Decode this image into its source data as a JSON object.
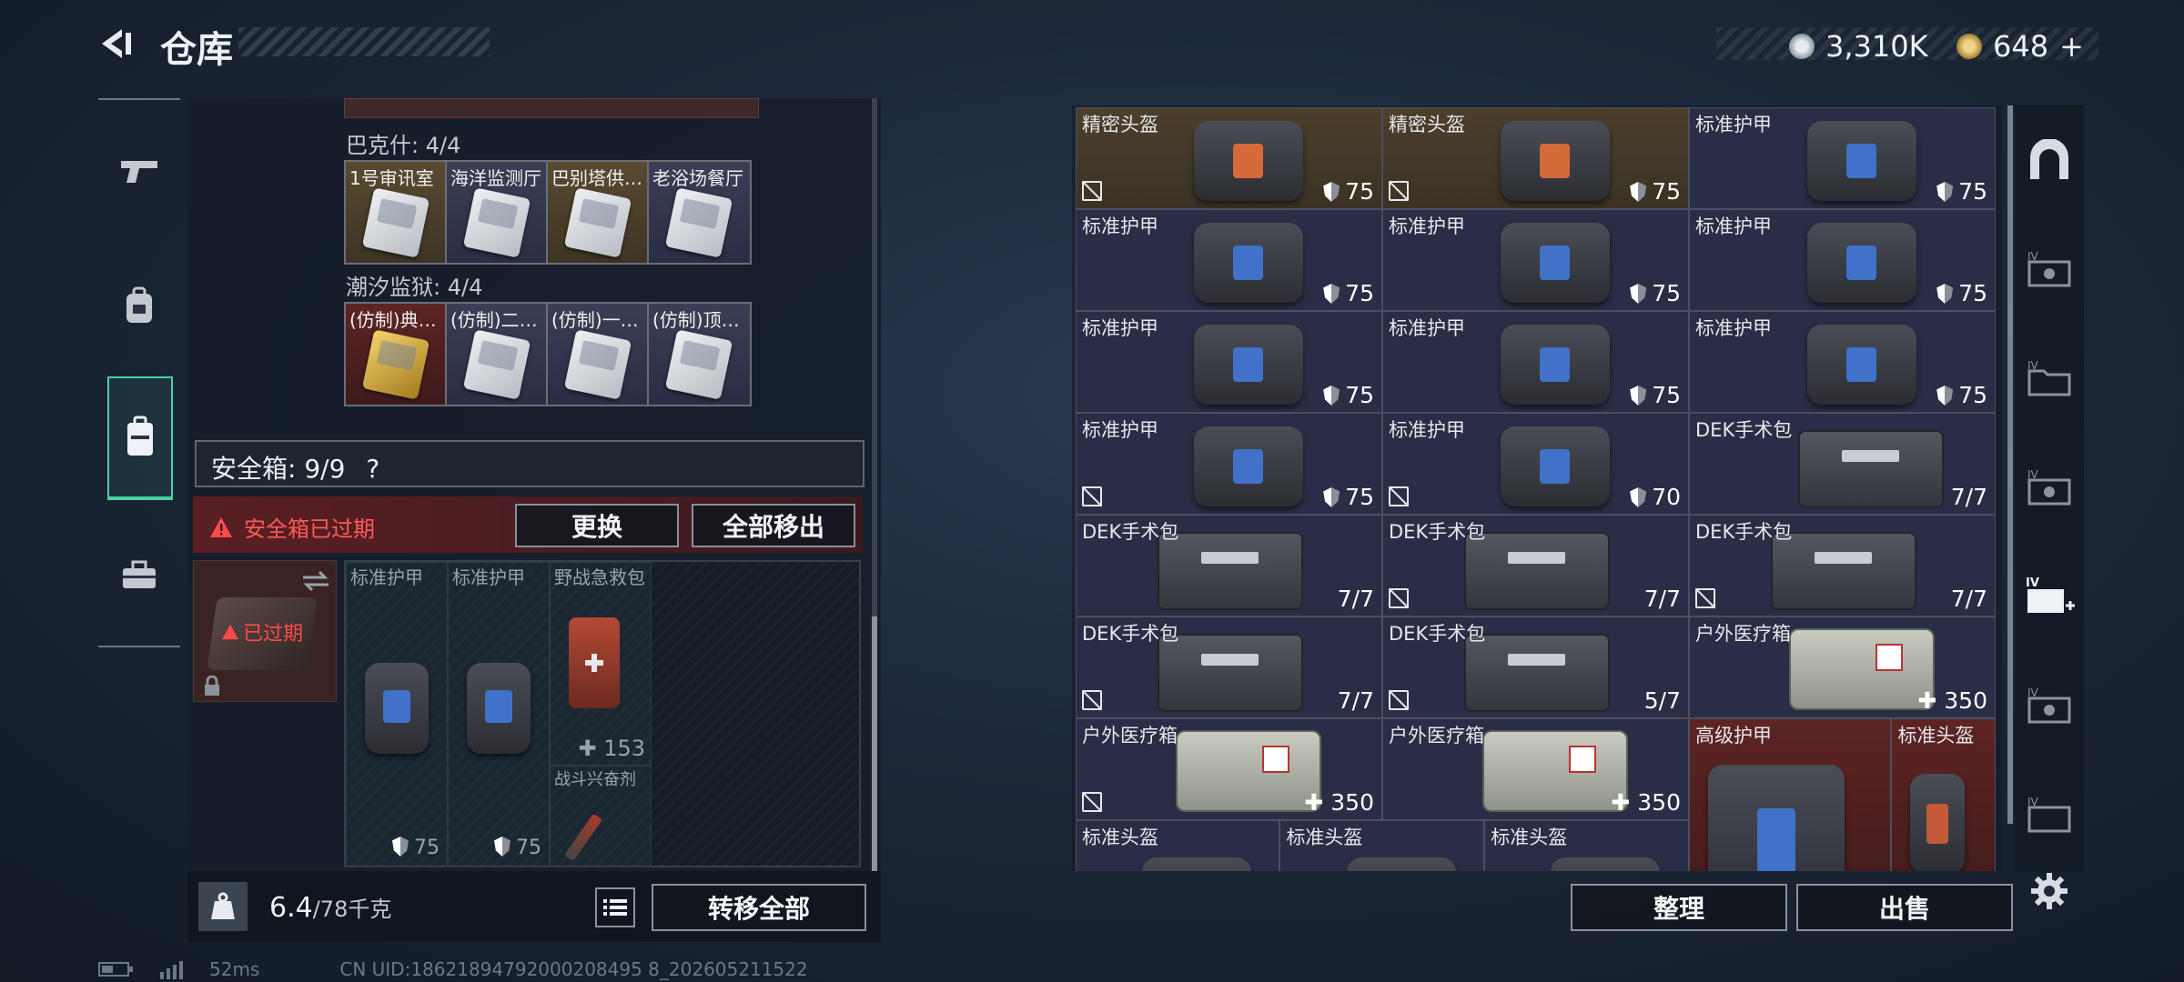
{
  "header": {
    "title": "仓库"
  },
  "currency": {
    "silver": "3,310K",
    "gold": "648",
    "gold_plus": "+"
  },
  "left": {
    "section_a": "巴克什: 4/4",
    "cards_a": [
      "1号审讯室",
      "海洋监测厅",
      "巴别塔供…",
      "老浴场餐厅"
    ],
    "section_b": "潮汐监狱: 4/4",
    "cards_b": [
      "(仿制)典…",
      "(仿制)二…",
      "(仿制)一…",
      "(仿制)顶…"
    ],
    "safe_label": "安全箱: 9/9",
    "safe_help": "?",
    "expired_warning": "安全箱已过期",
    "replace_button": "更换",
    "move_all_out_button": "全部移出",
    "expired_badge": "已过期",
    "safe_items": [
      {
        "name": "标准护甲",
        "value": "75"
      },
      {
        "name": "标准护甲",
        "value": "75"
      },
      {
        "name": "野战急救包",
        "value": "153"
      },
      {
        "name": "战斗兴奋剂",
        "value": ""
      }
    ],
    "weight_value": "6.4",
    "weight_max": "/78千克",
    "transfer_all_button": "转移全部"
  },
  "inventory": [
    {
      "name": "精密头盔",
      "value": "75",
      "type": "armor",
      "nosell": true,
      "bg": "gold"
    },
    {
      "name": "精密头盔",
      "value": "75",
      "type": "armor",
      "nosell": true,
      "bg": "gold"
    },
    {
      "name": "标准护甲",
      "value": "75",
      "type": "armor",
      "nosell": false,
      "bg": "blue"
    },
    {
      "name": "标准护甲",
      "value": "75",
      "type": "armor",
      "nosell": false,
      "bg": "blue"
    },
    {
      "name": "标准护甲",
      "value": "75",
      "type": "armor",
      "nosell": false,
      "bg": "blue"
    },
    {
      "name": "标准护甲",
      "value": "75",
      "type": "armor",
      "nosell": false,
      "bg": "blue"
    },
    {
      "name": "标准护甲",
      "value": "75",
      "type": "armor",
      "nosell": false,
      "bg": "blue"
    },
    {
      "name": "标准护甲",
      "value": "75",
      "type": "armor",
      "nosell": false,
      "bg": "blue"
    },
    {
      "name": "标准护甲",
      "value": "75",
      "type": "armor",
      "nosell": false,
      "bg": "blue"
    },
    {
      "name": "标准护甲",
      "value": "75",
      "type": "armor",
      "nosell": true,
      "bg": "blue"
    },
    {
      "name": "标准护甲",
      "value": "70",
      "type": "armor",
      "nosell": true,
      "bg": "blue"
    },
    {
      "name": "DEK手术包",
      "value": "7/7",
      "type": "kit",
      "nosell": false,
      "bg": "blue"
    },
    {
      "name": "DEK手术包",
      "value": "7/7",
      "type": "kit",
      "nosell": false,
      "bg": "blue"
    },
    {
      "name": "DEK手术包",
      "value": "7/7",
      "type": "kit",
      "nosell": true,
      "bg": "blue"
    },
    {
      "name": "DEK手术包",
      "value": "7/7",
      "type": "kit",
      "nosell": true,
      "bg": "blue"
    },
    {
      "name": "DEK手术包",
      "value": "7/7",
      "type": "kit",
      "nosell": true,
      "bg": "blue"
    },
    {
      "name": "DEK手术包",
      "value": "5/7",
      "type": "kit",
      "nosell": true,
      "bg": "blue"
    },
    {
      "name": "户外医疗箱",
      "value": "350",
      "type": "med",
      "nosell": false,
      "bg": "blue"
    },
    {
      "name": "户外医疗箱",
      "value": "350",
      "type": "med",
      "nosell": true,
      "bg": "blue"
    },
    {
      "name": "户外医疗箱",
      "value": "350",
      "type": "med",
      "nosell": false,
      "bg": "blue"
    },
    {
      "name": "高级护甲",
      "value": "",
      "type": "armor",
      "nosell": false,
      "bg": "red"
    },
    {
      "name": "标准头盔",
      "value": "",
      "type": "helmet",
      "nosell": false,
      "bg": "red"
    },
    {
      "name": "标准头盔",
      "value": "",
      "type": "helmet",
      "nosell": false,
      "bg": "blue"
    },
    {
      "name": "标准头盔",
      "value": "",
      "type": "helmet",
      "nosell": false,
      "bg": "blue"
    },
    {
      "name": "标准头盔",
      "value": "",
      "type": "helmet",
      "nosell": false,
      "bg": "blue"
    }
  ],
  "actions": {
    "sort_button": "整理",
    "sell_button": "出售"
  },
  "status": {
    "ping": "52ms",
    "uid": "CN UID:18621894792000208495 8_202605211522"
  }
}
